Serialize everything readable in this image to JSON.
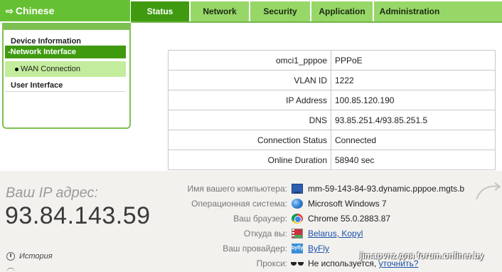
{
  "router": {
    "language": "Chinese",
    "tabs": [
      "Status",
      "Network",
      "Security",
      "Application",
      "Administration"
    ],
    "active_tab": "Status",
    "menu": {
      "device_information": "Device Information",
      "network_interface": "-Network Interface",
      "wan_connection": "WAN Connection",
      "user_interface": "User Interface"
    },
    "wan": [
      {
        "label": "omci1_pppoe",
        "value": "PPPoE"
      },
      {
        "label": "VLAN ID",
        "value": "1222"
      },
      {
        "label": "IP Address",
        "value": "100.85.120.190"
      },
      {
        "label": "DNS",
        "value": "93.85.251.4/93.85.251.5"
      },
      {
        "label": "Connection Status",
        "value": "Connected"
      },
      {
        "label": "Online Duration",
        "value": "58940 sec"
      }
    ]
  },
  "ipinfo": {
    "caption": "Ваш IP адрес:",
    "ip": "93.84.143.59",
    "history": "История",
    "rows": [
      {
        "label": "Имя вашего компьютера:",
        "value": "mm-59-143-84-93.dynamic.pppoe.mgts.b",
        "icon": "computer-icon"
      },
      {
        "label": "Операционная система:",
        "value": "Microsoft Windows 7",
        "icon": "windows-icon"
      },
      {
        "label": "Ваш браузер:",
        "value": "Chrome 55.0.2883.87",
        "icon": "chrome-icon"
      },
      {
        "label": "Откуда вы:",
        "value": "Belarus, Kopyl",
        "icon": "flag-icon"
      },
      {
        "label": "Ваш провайдер:",
        "value": "ByFly",
        "icon": "isp-icon",
        "icon_text": "byfly"
      },
      {
        "label": "Прокси:",
        "value": "Не используется,",
        "link": "уточнить?",
        "icon": "proxy-icon"
      }
    ],
    "watermark": "jimapvnz для forum.onliner.by"
  }
}
